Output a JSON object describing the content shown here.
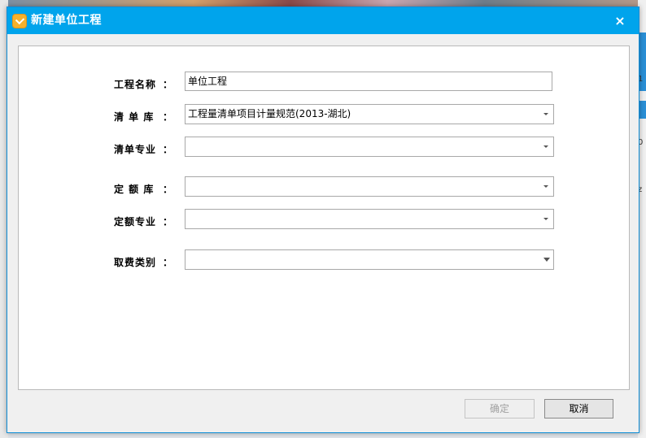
{
  "dialog": {
    "title": "新建单位工程",
    "close_glyph": "×"
  },
  "form": {
    "colon": "：",
    "fields": [
      {
        "label": "工程名称",
        "value": ""
      },
      {
        "label": "清 单 库",
        "value": "工程量清单项目计量规范(2013-湖北)"
      },
      {
        "label": "清单专业",
        "value": ""
      },
      {
        "label": "定 额 库",
        "value": ""
      },
      {
        "label": "定额专业",
        "value": ""
      },
      {
        "label": "取费类别",
        "value": ""
      }
    ],
    "project_name_value": "单位工程"
  },
  "buttons": {
    "ok": "确定",
    "cancel": "取消"
  },
  "background": {
    "right_fragments": [
      "1",
      "0",
      "z"
    ]
  }
}
